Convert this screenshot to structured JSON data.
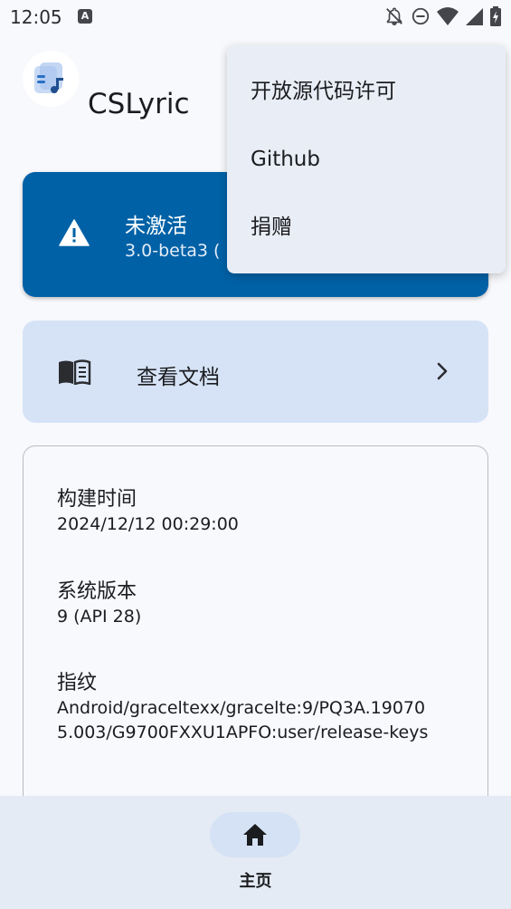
{
  "status_bar": {
    "time": "12:05",
    "notification_badge": "A",
    "icons": [
      "notifications-off-icon",
      "do-not-disturb-icon",
      "wifi-icon",
      "signal-icon",
      "battery-charging-icon"
    ]
  },
  "header": {
    "app_name": "CSLyric",
    "logo_icon": "lyric-note-icon"
  },
  "status_card": {
    "title": "未激活",
    "version": "3.0-beta3 (",
    "icon": "warning-icon",
    "background_color": "#0061a6"
  },
  "docs_card": {
    "label": "查看文档",
    "icon": "book-icon",
    "trailing_icon": "chevron-right-icon"
  },
  "info": {
    "build_time_label": "构建时间",
    "build_time_value": "2024/12/12 00:29:00",
    "system_version_label": "系统版本",
    "system_version_value": "9 (API 28)",
    "fingerprint_label": "指纹",
    "fingerprint_value": "Android/graceltexx/gracelte:9/PQ3A.190705.003/G9700FXXU1APFO:user/release-keys"
  },
  "bottom_nav": {
    "home_label": "主页",
    "home_icon": "home-icon"
  },
  "menu": {
    "items": [
      {
        "label": "开放源代码许可"
      },
      {
        "label": "Github"
      },
      {
        "label": "捐赠"
      }
    ]
  },
  "colors": {
    "primary": "#0061a6",
    "secondary_container": "#d6e3f6",
    "background": "#f8f9fc",
    "menu_background": "#e9edf5"
  }
}
